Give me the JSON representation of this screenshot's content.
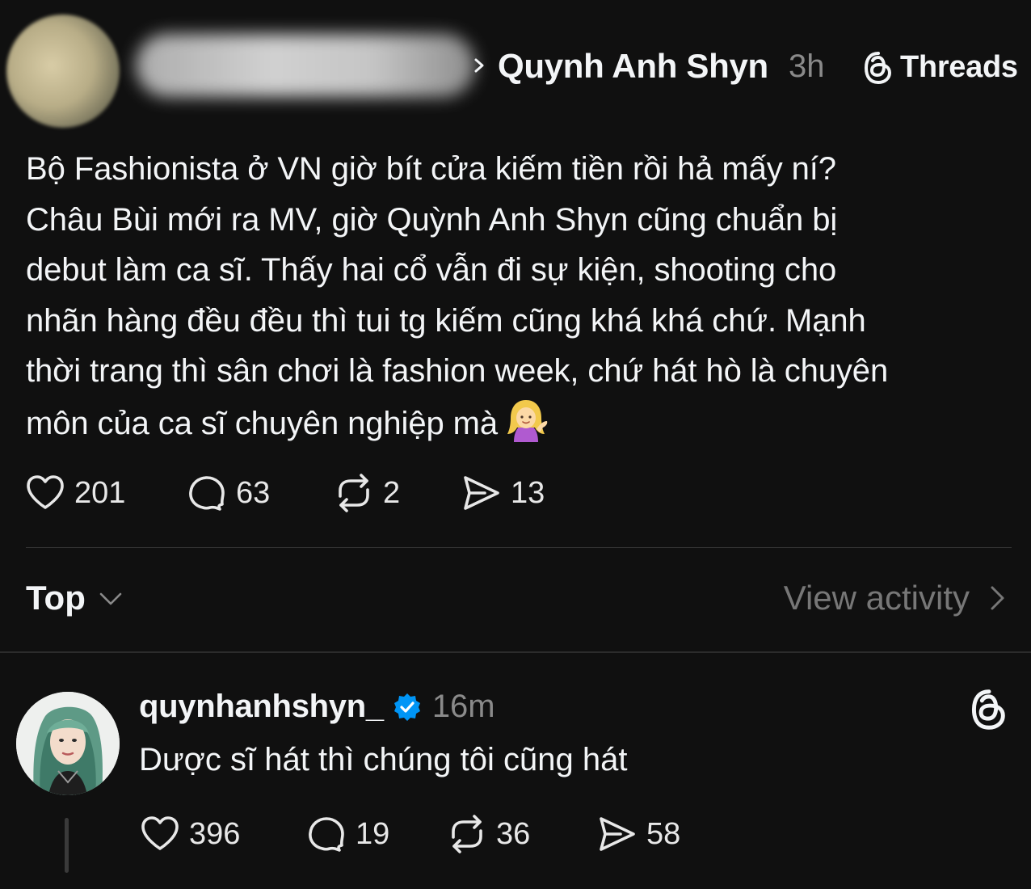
{
  "post": {
    "author": "Quynh Anh Shyn",
    "time": "3h",
    "brand": "Threads",
    "body_lines": [
      "Bộ Fashionista ở VN giờ bít cửa kiếm tiền rồi hả mấy ní?",
      "Châu Bùi mới ra MV, giờ Quỳnh Anh Shyn cũng chuẩn bị",
      "debut làm ca sĩ. Thấy hai cổ vẫn đi sự kiện, shooting cho",
      "nhãn hàng đều đều thì tui tg kiếm cũng khá khá chứ. Mạnh",
      "thời trang thì sân chơi là fashion week, chứ hát hò là chuyên",
      "môn của ca sĩ chuyên nghiệp mà"
    ],
    "emoji": "woman-tipping-hand",
    "stats": {
      "likes": "201",
      "replies": "63",
      "reposts": "2",
      "shares": "13"
    }
  },
  "sort": {
    "label": "Top"
  },
  "activity": {
    "label": "View activity"
  },
  "reply": {
    "username": "quynhanhshyn_",
    "time": "16m",
    "text": "Dược sĩ hát thì chúng tôi cũng hát",
    "stats": {
      "likes": "396",
      "replies": "19",
      "reposts": "36",
      "shares": "58"
    }
  },
  "colors": {
    "background": "#101010",
    "text": "#f3f5f7",
    "muted": "#8a8a8a",
    "verified": "#0095f6"
  }
}
